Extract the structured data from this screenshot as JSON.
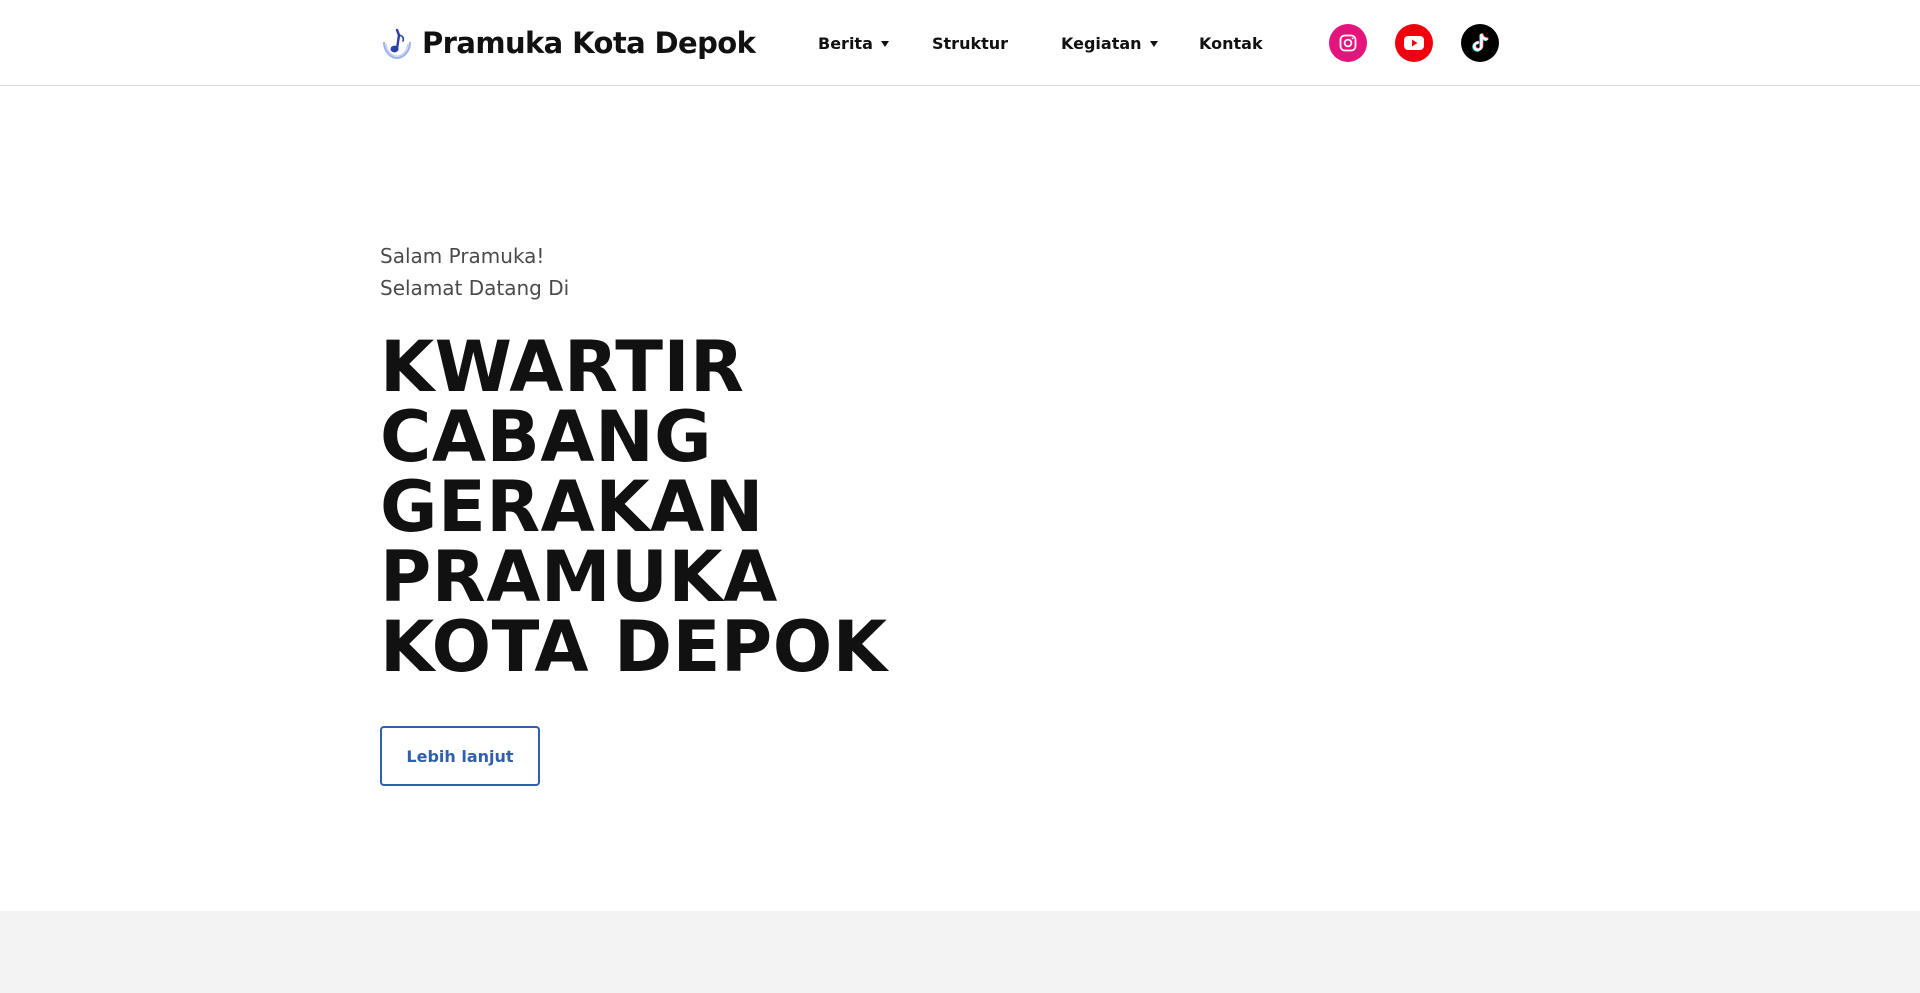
{
  "brand": {
    "name": "Pramuka Kota Depok",
    "logo_icon": "scout-emblem-icon"
  },
  "nav": {
    "items": [
      {
        "label": "Berita",
        "has_dropdown": true
      },
      {
        "label": "Struktur",
        "has_dropdown": false
      },
      {
        "label": "Kegiatan",
        "has_dropdown": true
      },
      {
        "label": "Kontak",
        "has_dropdown": false
      }
    ]
  },
  "social": [
    {
      "name": "instagram-icon",
      "color": "#e4147d"
    },
    {
      "name": "youtube-icon",
      "color": "#f0000e"
    },
    {
      "name": "tiktok-icon",
      "color": "#000000"
    }
  ],
  "hero": {
    "greeting_line1": "Salam Pramuka!",
    "greeting_line2": "Selamat Datang Di",
    "title_lines": [
      "KWARTIR",
      "CABANG",
      "GERAKAN",
      "PRAMUKA",
      "KOTA DEPOK"
    ],
    "cta_label": "Lebih lanjut"
  },
  "colors": {
    "accent": "#2f5fad",
    "text": "#111111",
    "muted": "#4a4a4a",
    "footer_band": "#f3f3f3",
    "header_border": "#d9d9d9"
  }
}
